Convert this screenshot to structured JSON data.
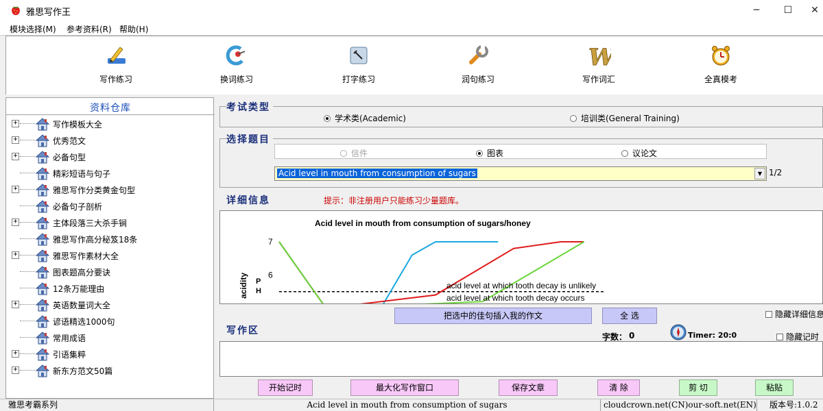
{
  "window": {
    "title": "雅思写作王",
    "minimize_glyph": "─",
    "maximize_glyph": "☐",
    "close_glyph": "✕",
    "icon": "strawberry-icon"
  },
  "menu": [
    {
      "label": "模块选择(M)"
    },
    {
      "label": "参考资料(R)"
    },
    {
      "label": "帮助(H)"
    }
  ],
  "toolbar": [
    {
      "label": "写作练习",
      "icon": "pen-icon"
    },
    {
      "label": "换词练习",
      "icon": "swap-icon"
    },
    {
      "label": "打字练习",
      "icon": "typing-icon"
    },
    {
      "label": "润句练习",
      "icon": "wrench-icon"
    },
    {
      "label": "写作词汇",
      "icon": "vocabulary-w-icon"
    },
    {
      "label": "全真模考",
      "icon": "alarm-clock-icon"
    }
  ],
  "resources": {
    "title": "资料仓库",
    "items": [
      {
        "label": "写作模板大全",
        "expandable": true
      },
      {
        "label": "优秀范文",
        "expandable": true
      },
      {
        "label": "必备句型",
        "expandable": true
      },
      {
        "label": "精彩短语与句子",
        "expandable": false
      },
      {
        "label": "雅思写作分类黄金句型",
        "expandable": true
      },
      {
        "label": "必备句子剖析",
        "expandable": false
      },
      {
        "label": "主体段落三大杀手锏",
        "expandable": true
      },
      {
        "label": "雅思写作高分秘笈18条",
        "expandable": false
      },
      {
        "label": "雅思写作素材大全",
        "expandable": true
      },
      {
        "label": "图表题高分要诀",
        "expandable": false
      },
      {
        "label": "12条万能理由",
        "expandable": false
      },
      {
        "label": "英语数量词大全",
        "expandable": true
      },
      {
        "label": "谚语精选1000句",
        "expandable": false
      },
      {
        "label": "常用成语",
        "expandable": false
      },
      {
        "label": "引语集粹",
        "expandable": true
      },
      {
        "label": "新东方范文50篇",
        "expandable": true
      }
    ]
  },
  "exam_type": {
    "title": "考试类型",
    "options": [
      {
        "label": "学术类(Academic)",
        "selected": true
      },
      {
        "label": "培训类(General Training)",
        "selected": false
      }
    ]
  },
  "topic": {
    "title": "选择题目",
    "types": [
      {
        "label": "信件",
        "selected": false,
        "disabled": true
      },
      {
        "label": "图表",
        "selected": true,
        "disabled": false
      },
      {
        "label": "议论文",
        "selected": false,
        "disabled": false
      }
    ],
    "selected_topic": "Acid level in mouth from consumption of sugars",
    "counter": "1/2"
  },
  "detail": {
    "title": "详细信息",
    "hint": "提示：非注册用户只能练习少量题库。",
    "chart_title": "Acid level in mouth from consumption of sugars/honey",
    "y_axis_label": "acidity",
    "ph_label_p": "P",
    "ph_label_h": "H",
    "line_unlikely": "acid level at which tooth decay is unlikely",
    "line_occurs": "acid level at which tooth decay occurs",
    "insert_button": "把选中的佳句插入我的作文",
    "select_all_button": "全 选",
    "hide_detail_label": "隐藏详细信息"
  },
  "chart_data": {
    "type": "line",
    "title": "Acid level in mouth from consumption of sugars/honey",
    "ylabel": "acidity",
    "y_ticks": [
      7,
      6
    ],
    "series": [
      {
        "color": "#1aa8e0",
        "points": [
          [
            0,
            7.0
          ],
          [
            6,
            5.0
          ],
          [
            13,
            5.0
          ],
          [
            17,
            6.6
          ],
          [
            20,
            7.0
          ],
          [
            28,
            7.0
          ]
        ]
      },
      {
        "color": "#e01a1a",
        "points": [
          [
            0,
            7.0
          ],
          [
            6,
            5.0
          ],
          [
            20,
            5.4
          ],
          [
            25,
            6.1
          ],
          [
            30,
            6.8
          ],
          [
            36,
            7.0
          ],
          [
            39,
            7.0
          ]
        ]
      },
      {
        "color": "#6ad63a",
        "points": [
          [
            0,
            7.0
          ],
          [
            6,
            5.0
          ],
          [
            26,
            5.2
          ],
          [
            39,
            7.0
          ]
        ]
      }
    ],
    "thresholds": [
      {
        "value": 5.5,
        "label": "acid level at which tooth decay is unlikely"
      },
      {
        "value": 5.5,
        "label": "acid level at which tooth decay occurs"
      }
    ]
  },
  "writing": {
    "title": "写作区",
    "word_count_label": "字数：",
    "word_count": "0",
    "timer": "Timer: 20:0",
    "hide_timer_label": "隐藏记时"
  },
  "bottom_buttons": [
    {
      "label": "开始记时"
    },
    {
      "label": "最大化写作窗口"
    },
    {
      "label": "保存文章"
    },
    {
      "label": "清 除"
    },
    {
      "label": "剪 切"
    },
    {
      "label": "粘贴"
    }
  ],
  "status": {
    "series": "雅思考霸系列",
    "topic": "Acid level in mouth from consumption of sugars",
    "site": "cloudcrown.net(CN)our-soft.net(EN)",
    "version": "版本号:1.0.2"
  }
}
